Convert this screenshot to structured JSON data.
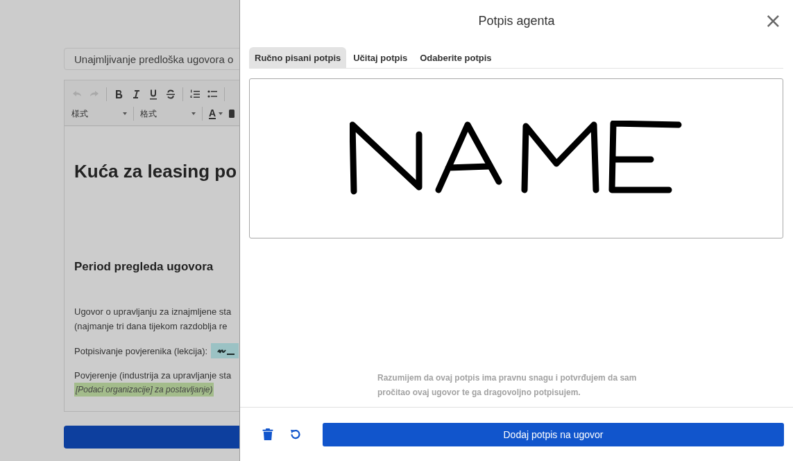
{
  "page": {
    "title_field": {
      "value": "Unajmljivanje predloška ugovora o"
    },
    "editor": {
      "dropdowns": [
        "様式",
        "格式"
      ],
      "color_button": "A",
      "heading": "Kuća za leasing po",
      "section_heading": "Period pregleda ugovora",
      "blocks": [
        {
          "kind": "text",
          "lines": [
            "Ugovor o upravljanju za iznajmljene sta",
            "(najmanje tri dana tijekom razdoblja re"
          ]
        },
        {
          "kind": "signature",
          "lines": [
            "Potpisivanje povjerenika (lekcija):"
          ]
        },
        {
          "kind": "note",
          "lines": [
            "Povjerenje (industrija za upravljanje sta",
            "[Podaci organizacije] za postavljanje)"
          ]
        }
      ]
    }
  },
  "dialog": {
    "title": "Potpis agenta",
    "close": "×",
    "tabs": [
      {
        "label": "Ručno pisani potpis",
        "selected": true
      },
      {
        "label": "Učitaj potpis",
        "selected": false
      },
      {
        "label": "Odaberite potpis",
        "selected": false
      }
    ],
    "notice": "Razumijem da ovaj potpis ima pravnu snagu i potvrđujem da sam pročitao ovaj ugovor te ga dragovoljno potpisujem.",
    "submit_button": "Dodaj potpis na ugovor"
  }
}
